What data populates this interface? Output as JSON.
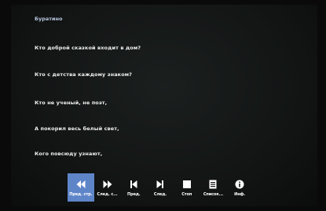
{
  "song_title": "Буратино",
  "lyrics": [
    "Кто доброй сказкой входит в дом?",
    "Кто с детства каждому знаком?",
    "Кто не ученый, не поэт,",
    "А покорил весь белый свет,",
    "Кого повсюду узнают,"
  ],
  "toolbar": {
    "prev_verse": "Пред. стр.",
    "next_verse": "След. с...",
    "prev": "Пред.",
    "next": "След.",
    "stop": "Стоп",
    "list": "Список...",
    "info": "Инф."
  },
  "colors": {
    "accent": "#5f85c9",
    "title": "#b8c4de"
  },
  "icons": [
    "rewind-icon",
    "fast-forward-icon",
    "skip-previous-icon",
    "skip-next-icon",
    "stop-icon",
    "list-icon",
    "info-icon"
  ]
}
